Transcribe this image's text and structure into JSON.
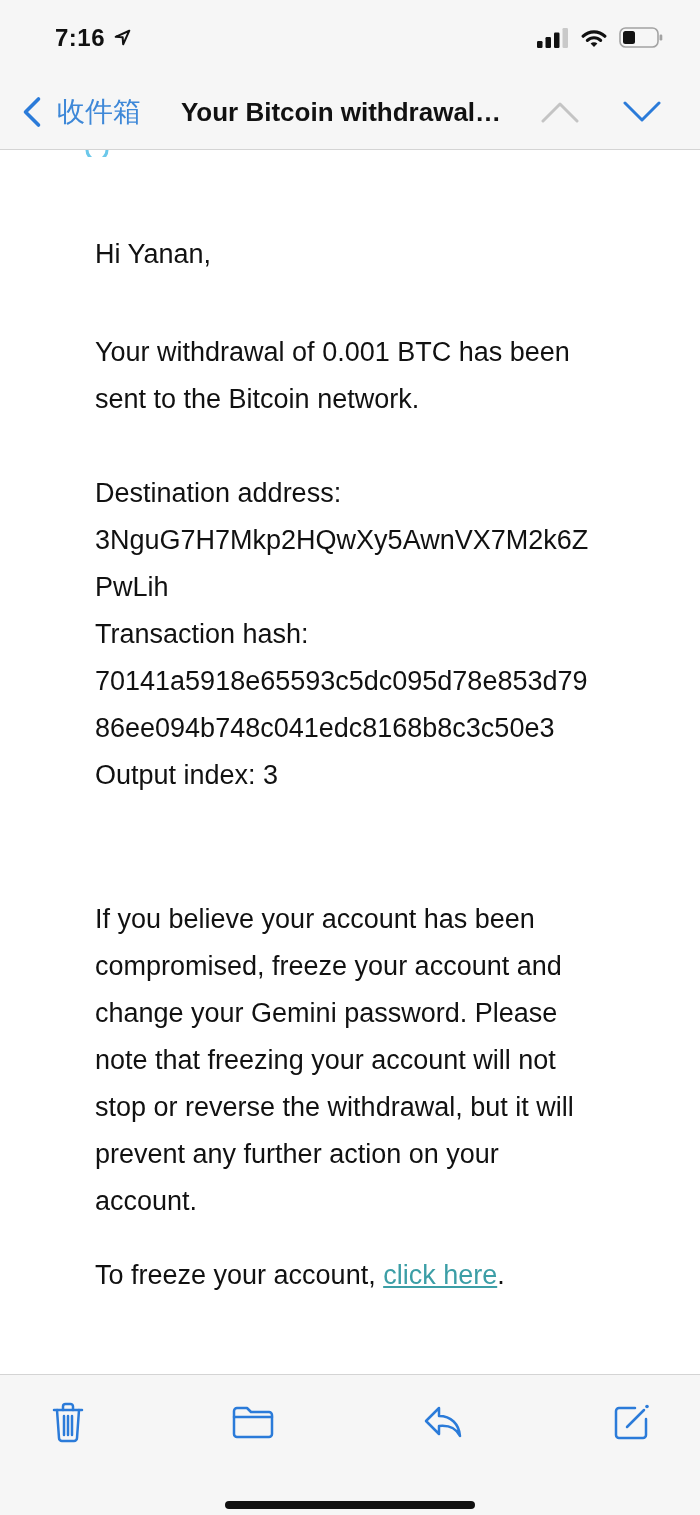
{
  "status_bar": {
    "time": "7:16"
  },
  "nav": {
    "back_label": "收件箱",
    "title": "Your Bitcoin withdrawal…",
    "previous": {
      "disabled": true
    },
    "next": {
      "disabled": false
    }
  },
  "email": {
    "greeting": "Hi Yanan,",
    "intro": "Your withdrawal of 0.001 BTC has been sent to the Bitcoin network.",
    "details": [
      "Destination address:",
      "3NguG7H7Mkp2HQwXy5AwnVX7M2k6ZPwLih",
      "Transaction hash:",
      "70141a5918e65593c5dc095d78e853d7986ee094b748c041edc8168b8c3c50e3",
      "Output index: 3"
    ],
    "warning": "If you believe your account has been compromised, freeze your account and change your Gemini password. Please note that freezing your account will not stop or reverse the withdrawal, but it will prevent any further action on your account.",
    "freeze": {
      "text": "To freeze your account, ",
      "link": "click here",
      "end": "."
    }
  }
}
